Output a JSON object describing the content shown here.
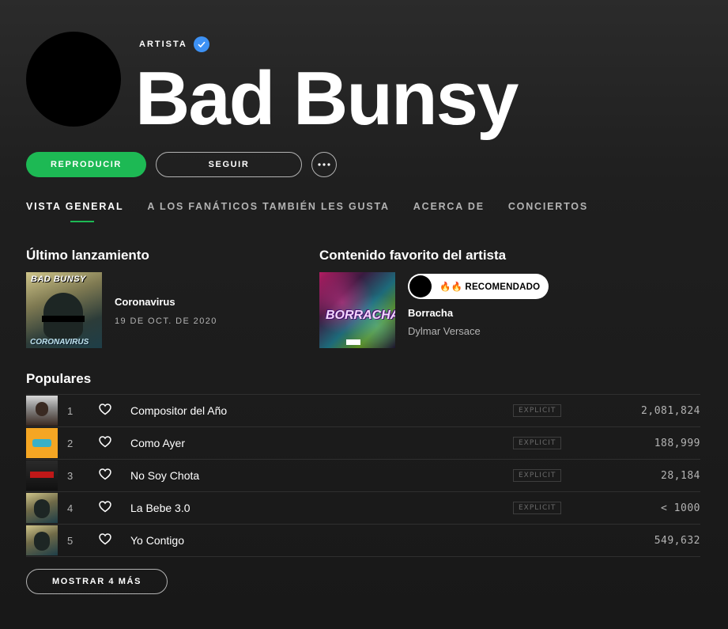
{
  "header": {
    "artist_label": "ARTISTA",
    "artist_name": "Bad Bunsy",
    "verified_icon": "verified-badge-icon"
  },
  "actions": {
    "play_label": "REPRODUCIR",
    "follow_label": "SEGUIR",
    "more_icon": "more-options-icon"
  },
  "tabs": [
    {
      "label": "VISTA GENERAL",
      "active": true
    },
    {
      "label": "A LOS FANÁTICOS TAMBIÉN LES GUSTA",
      "active": false
    },
    {
      "label": "ACERCA DE",
      "active": false
    },
    {
      "label": "CONCIERTOS",
      "active": false
    }
  ],
  "latest_release": {
    "heading": "Último lanzamiento",
    "title": "Coronavirus",
    "date": "19 DE OCT. DE 2020",
    "cover_text_top": "BAD BUNSY",
    "cover_text_bottom": "CORONAVIRUS"
  },
  "artist_pick": {
    "heading": "Contenido favorito del artista",
    "badge_label": "🔥🔥 RECOMENDADO",
    "title": "Borracha",
    "artist": "Dylmar Versace",
    "cover_text": "BORRACHA"
  },
  "popular": {
    "heading": "Populares",
    "explicit_label": "EXPLICIT",
    "tracks": [
      {
        "num": "1",
        "name": "Compositor del Año",
        "explicit": true,
        "plays": "2,081,824"
      },
      {
        "num": "2",
        "name": "Como Ayer",
        "explicit": true,
        "plays": "188,999"
      },
      {
        "num": "3",
        "name": "No Soy Chota",
        "explicit": true,
        "plays": "28,184"
      },
      {
        "num": "4",
        "name": "La Bebe 3.0",
        "explicit": true,
        "plays": "< 1000"
      },
      {
        "num": "5",
        "name": "Yo Contigo",
        "explicit": false,
        "plays": "549,632"
      }
    ],
    "show_more_label": "MOSTRAR 4 MÁS"
  },
  "colors": {
    "accent": "#1db954",
    "verified": "#3d91f4",
    "background": "#181818",
    "muted_text": "#b3b3b3"
  }
}
